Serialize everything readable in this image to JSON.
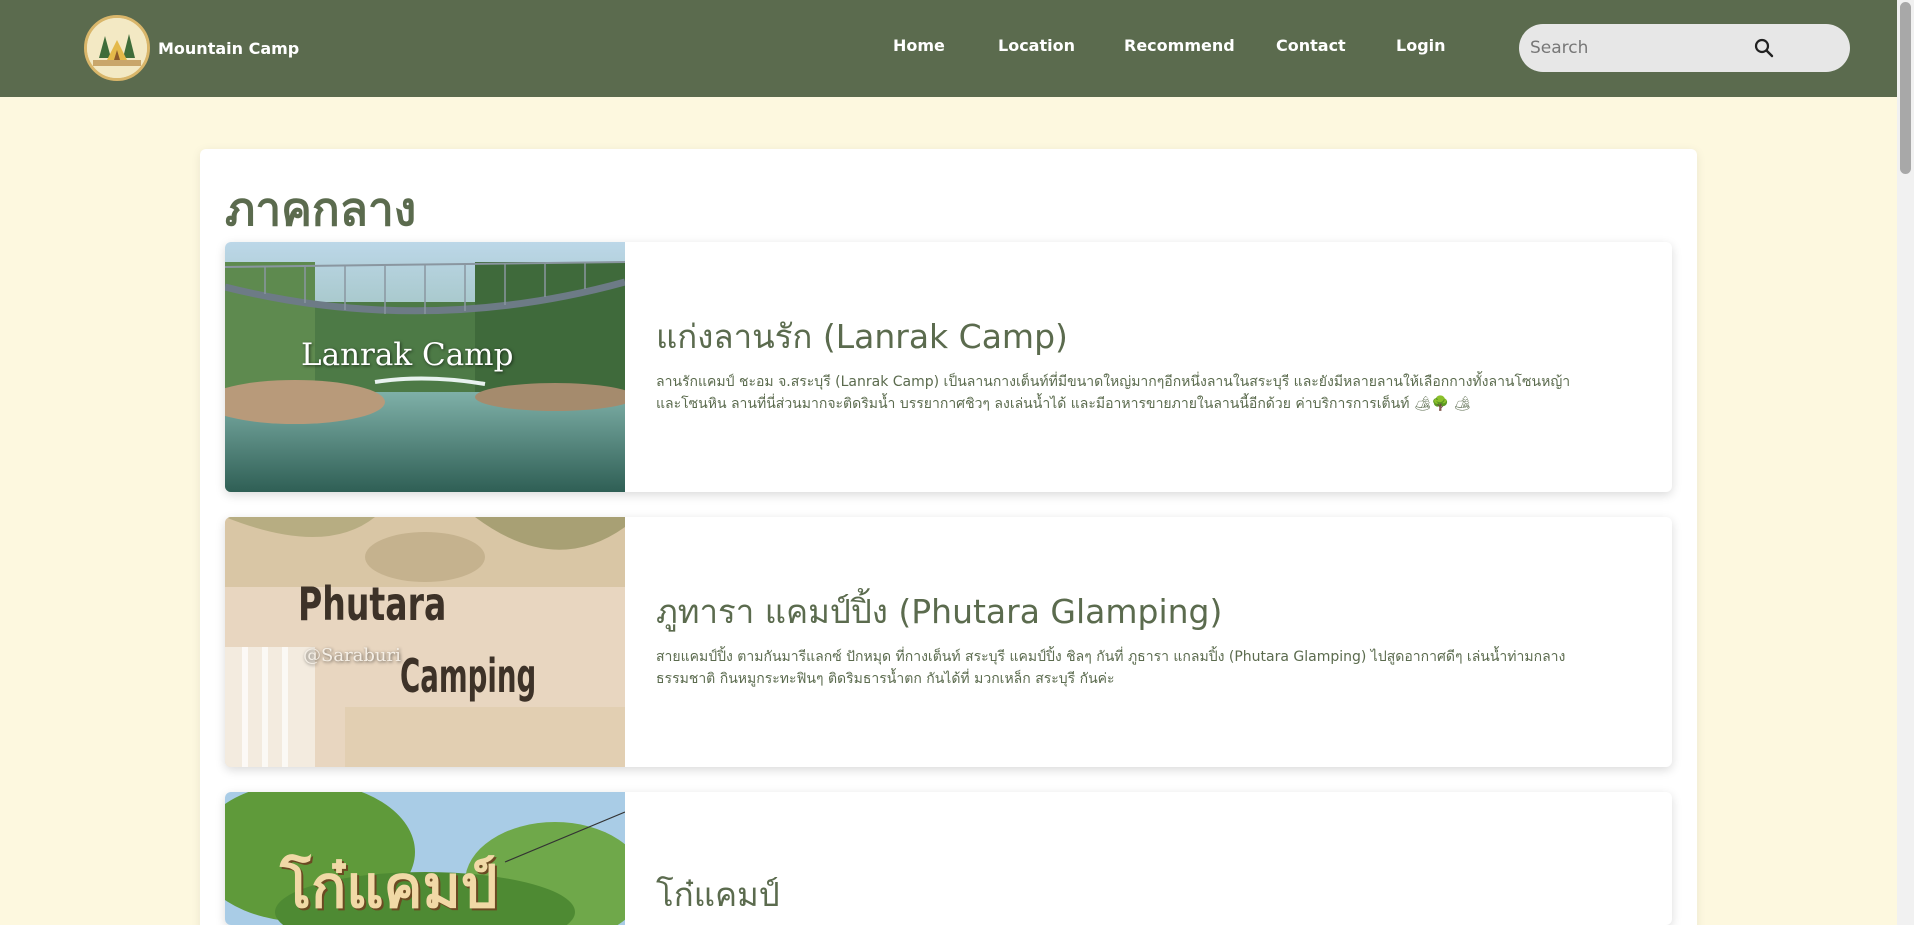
{
  "navbar": {
    "brand": "Mountain Camp",
    "logo_text": "MOUNTAINCAMP",
    "links": [
      "Home",
      "Location",
      "Recommend",
      "Contact",
      "Login"
    ],
    "search_placeholder": "Search"
  },
  "main": {
    "region_title": "ภาคกลาง",
    "camps": [
      {
        "title": "แก่งลานรัก (Lanrak Camp)",
        "description": "ลานรักแคมป์ ชะอม จ.สระบุรี (Lanrak Camp) เป็นลานกางเต็นท์ที่มีขนาดใหญ่มากๆอีกหนึ่งลานในสระบุรี และยังมีหลายลานให้เลือกกางทั้งลานโซนหญ้าและโซนหิน ลานที่นี่ส่วนมากจะติดริมน้ำ บรรยากาศชิวๆ ลงเล่นน้ำได้ และมีอาหารขายภายในลานนี้อีกด้วย ค่าบริการการเต็นท์ 🏕🌳 🏕",
        "image_caption": "Lanrak Camp"
      },
      {
        "title": "ภูทารา แคมป์ปิ้ง (Phutara Glamping)",
        "description": "สายแคมป์ปิ้ง ตามกันมารีแลกซ์ ปักหมุด ที่กางเต็นท์ สระบุรี แคมป์ปิ้ง ชิลๆ กันที่ ภูธารา แกลมปิ้ง (Phutara Glamping) ไปสูดอากาศดีๆ เล่นน้ำท่ามกลางธรรมชาติ กินหมูกระทะฟินๆ ติดริมธารน้ำตก กันได้ที่ มวกเหล็ก สระบุรี กันค่ะ",
        "image_caption_1": "Phutara",
        "image_caption_2": "@Saraburi",
        "image_caption_3": "Camping"
      },
      {
        "title": "โก๋แคมป์",
        "description": "",
        "image_caption": "โก๋แคมป์"
      }
    ]
  },
  "colors": {
    "nav_bg": "#5b6b4e",
    "page_bg": "#fdf8df",
    "accent_text": "#5b6b4e"
  }
}
